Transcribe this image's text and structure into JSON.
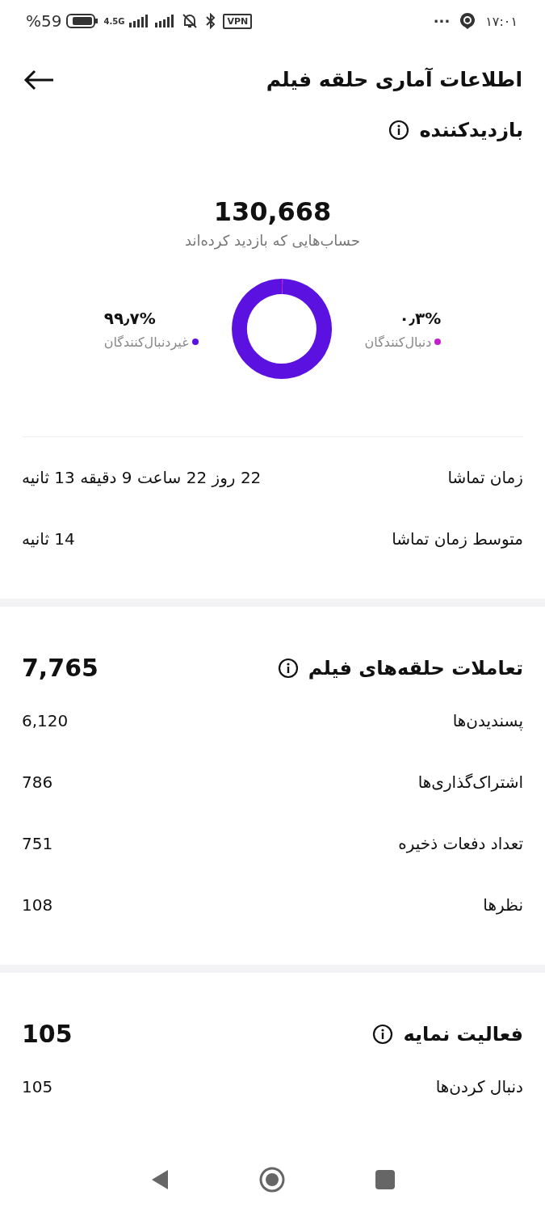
{
  "status_bar": {
    "battery": "%59",
    "network": "4.5G",
    "vpn": "VPN",
    "more": "···",
    "time": "۱۷:۰۱"
  },
  "header": {
    "title": "اطلاعات آماری حلقه فیلم"
  },
  "viewers": {
    "title": "بازدیدکننده",
    "total": "130,668",
    "caption": "حساب‌هایی که بازدید کرده‌اند",
    "legend": [
      {
        "percent": "۰٫۳%",
        "label": "دنبال‌کنندگان",
        "color": "#c21fc8"
      },
      {
        "percent": "۹۹٫۷%",
        "label": "غیردنبال‌کنندگان",
        "color": "#5b12e0"
      }
    ],
    "chart_data": {
      "type": "donut",
      "values": [
        0.3,
        99.7
      ]
    },
    "rows": [
      {
        "label": "زمان تماشا",
        "value": "22 روز 22 ساعت 9 دقیقه 13 ثانیه"
      },
      {
        "label": "متوسط زمان تماشا",
        "value": "14 ثانیه"
      }
    ]
  },
  "sections": [
    {
      "title": "تعاملات حلقه‌های فیلم",
      "total": "7,765",
      "rows": [
        {
          "label": "پسندیدن‌ها",
          "value": "6,120"
        },
        {
          "label": "اشتراک‌گذاری‌ها",
          "value": "786"
        },
        {
          "label": "تعداد دفعات ذخیره",
          "value": "751"
        },
        {
          "label": "نظرها",
          "value": "108"
        }
      ]
    },
    {
      "title": "فعالیت نمایه",
      "total": "105",
      "rows": [
        {
          "label": "دنبال کردن‌ها",
          "value": "105"
        }
      ]
    }
  ]
}
